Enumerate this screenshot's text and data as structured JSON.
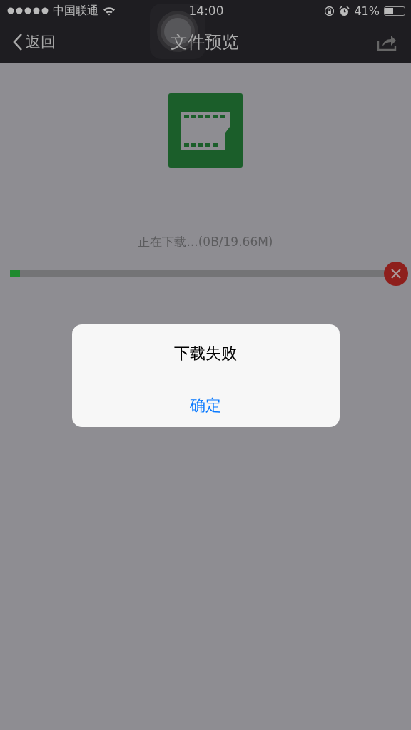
{
  "status_bar": {
    "carrier": "中国联通",
    "time": "14:00",
    "battery": "41%"
  },
  "nav_bar": {
    "back": "返回",
    "title": "文件预览"
  },
  "download": {
    "status": "正在下载...(0B/19.66M)",
    "level": 0.027
  },
  "dialog": {
    "title": "下载失败",
    "buttons": [
      "确定"
    ]
  }
}
